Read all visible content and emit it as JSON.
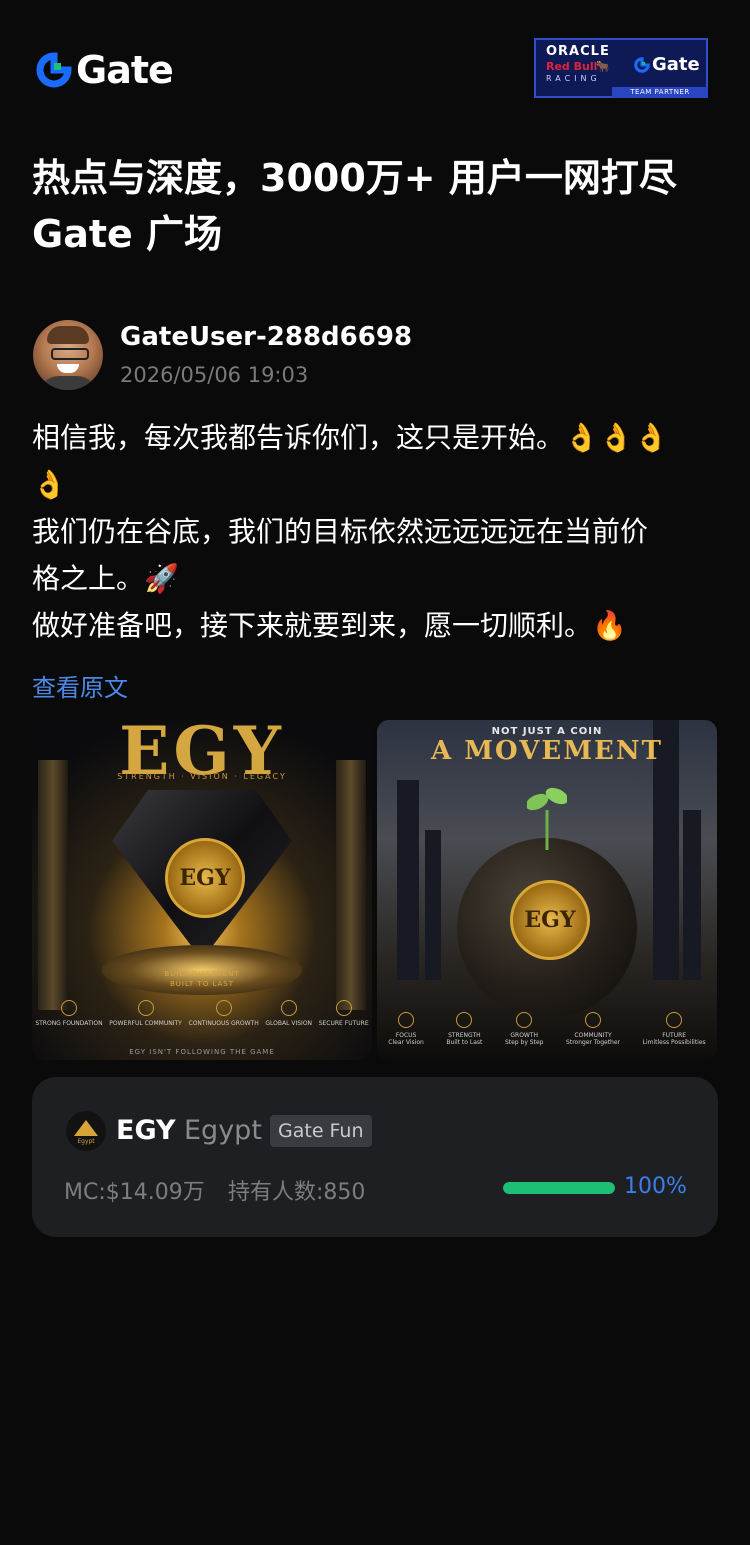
{
  "header": {
    "logo_text": "Gate",
    "partner": {
      "oracle": "ORACLE",
      "redbull": "Red Bull",
      "racing": "RACING",
      "gate": "Gate",
      "badge": "TEAM PARTNER"
    }
  },
  "headline": {
    "line1": "热点与深度，3000万+ 用户一网打尽",
    "line2": "Gate 广场"
  },
  "post": {
    "username": "GateUser-288d6698",
    "timestamp": "2026/05/06 19:03",
    "lines": [
      "相信我，每次我都告诉你们，这只是开始。👌👌👌",
      "👌",
      "我们仍在谷底，我们的目标依然远远远远在当前价",
      "格之上。🚀",
      "做好准备吧，接下来就要到来，愿一切顺利。🔥"
    ],
    "view_original": "查看原文"
  },
  "images": [
    {
      "title": "EGY",
      "subtitle": "STRENGTH · VISION · LEGACY",
      "coin": "EGY",
      "caption1": "BUILT DIFFERENT",
      "caption2": "BUILT TO LAST",
      "features": [
        "STRONG FOUNDATION",
        "POWERFUL COMMUNITY",
        "CONTINUOUS GROWTH",
        "GLOBAL VISION",
        "SECURE FUTURE"
      ],
      "footer": "EGY ISN'T FOLLOWING THE GAME"
    },
    {
      "kicker": "NOT JUST A COIN",
      "title": "A MOVEMENT",
      "coin": "EGY",
      "features": [
        "FOCUS",
        "STRENGTH",
        "GROWTH",
        "COMMUNITY",
        "FUTURE"
      ],
      "feature_subs": [
        "Clear Vision",
        "Built to Last",
        "Step by Step",
        "Stronger Together",
        "Limitless Possibilities"
      ]
    }
  ],
  "token": {
    "logo_text": "Egypt",
    "symbol": "EGY",
    "name": "Egypt",
    "tag": "Gate Fun",
    "market_cap": "MC:$14.09万",
    "holders": "持有人数:850",
    "progress_text": "100%",
    "progress_value": 1.0,
    "progress_color": "#1dbf73",
    "percent_color": "#3b7fe8"
  },
  "colors": {
    "background": "#0a0a0a",
    "card": "#1e1f23",
    "link": "#4d8ae8",
    "brand": "#1a6bff",
    "brand_accent": "#18c47c"
  }
}
